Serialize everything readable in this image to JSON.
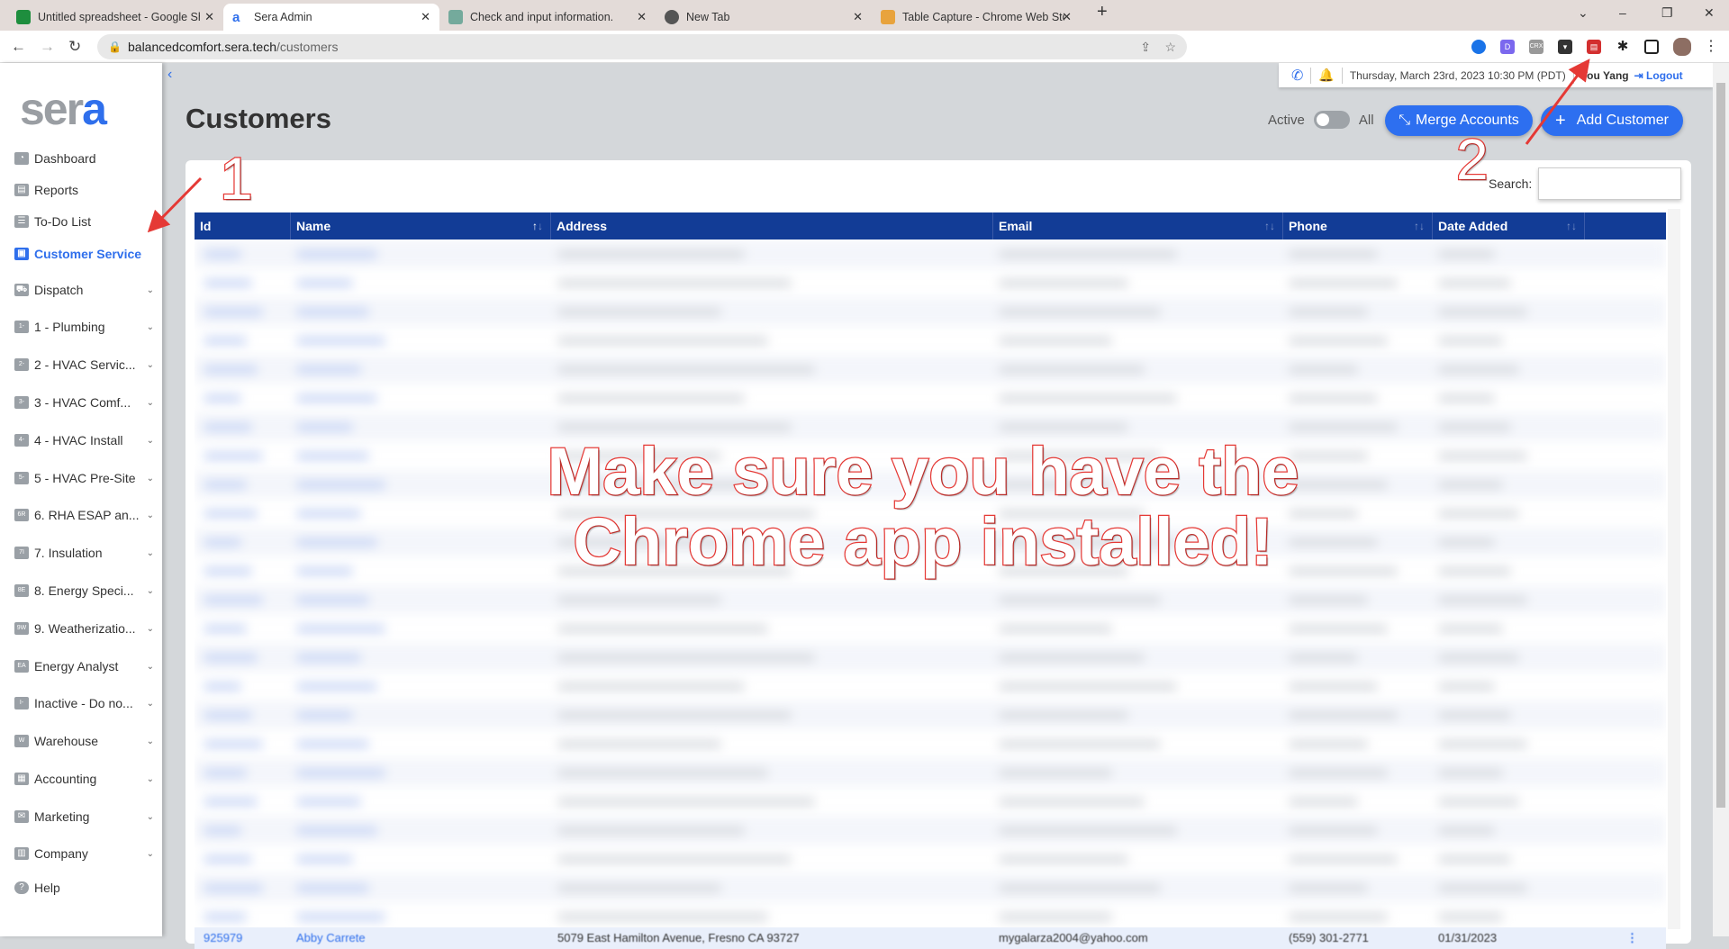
{
  "browser": {
    "tabs": [
      {
        "title": "Untitled spreadsheet - Google Sh",
        "color": "#1e8e3e"
      },
      {
        "title": "Sera Admin",
        "color": "#2f6fec",
        "active": true
      },
      {
        "title": "Check and input information.",
        "color": "#74aa9c"
      },
      {
        "title": "New Tab",
        "color": "#555555"
      },
      {
        "title": "Table Capture - Chrome Web Sto",
        "color": "#e8a33d"
      }
    ],
    "new_tab": "+",
    "url_host": "balancedcomfort.sera.tech",
    "url_path": "/customers",
    "extensions": [
      "onepassword-icon",
      "d-extension-icon",
      "crx-icon",
      "pocket-icon",
      "table-capture-icon",
      "puzzle-icon",
      "sidepanel-icon",
      "profile-avatar"
    ]
  },
  "sidebar": {
    "logo": "sera",
    "items": [
      {
        "label": "Dashboard",
        "icon": "pie-chart-icon",
        "badge": ""
      },
      {
        "label": "Reports",
        "icon": "report-icon",
        "badge": ""
      },
      {
        "label": "To-Do List",
        "icon": "list-icon",
        "badge": ""
      },
      {
        "label": "Customer Service",
        "icon": "contact-card-icon",
        "badge": "",
        "active": true
      },
      {
        "label": "Dispatch",
        "icon": "truck-icon",
        "badge": "",
        "chevron": true
      },
      {
        "label": "1 - Plumbing",
        "badge": "1-",
        "chevron": true
      },
      {
        "label": "2 - HVAC Servic...",
        "badge": "2-",
        "chevron": true
      },
      {
        "label": "3 - HVAC Comf...",
        "badge": "3-",
        "chevron": true
      },
      {
        "label": "4 - HVAC Install",
        "badge": "4-",
        "chevron": true
      },
      {
        "label": "5 - HVAC Pre-Site",
        "badge": "5-",
        "chevron": true
      },
      {
        "label": "6. RHA ESAP an...",
        "badge": "6R",
        "chevron": true
      },
      {
        "label": "7. Insulation",
        "badge": "7I",
        "chevron": true
      },
      {
        "label": "8. Energy Speci...",
        "badge": "8E",
        "chevron": true
      },
      {
        "label": "9. Weatherizatio...",
        "badge": "9W",
        "chevron": true
      },
      {
        "label": "Energy Analyst",
        "badge": "EA",
        "chevron": true
      },
      {
        "label": "Inactive - Do no...",
        "badge": "I-",
        "chevron": true
      },
      {
        "label": "Warehouse",
        "badge": "W",
        "chevron": true
      },
      {
        "label": "Accounting",
        "icon": "calculator-icon",
        "badge": "",
        "chevron": true
      },
      {
        "label": "Marketing",
        "icon": "envelope-icon",
        "badge": "",
        "chevron": true
      },
      {
        "label": "Company",
        "icon": "building-icon",
        "badge": "",
        "chevron": true
      },
      {
        "label": "Help",
        "icon": "help-icon",
        "badge": ""
      }
    ]
  },
  "topbar": {
    "datetime": "Thursday, March 23rd, 2023 10:30 PM (PDT)",
    "user": "Tou Yang",
    "logout": "Logout"
  },
  "page": {
    "title": "Customers",
    "toggle_active": "Active",
    "toggle_all": "All",
    "merge_button": "Merge Accounts",
    "add_button": "Add Customer",
    "search_label": "Search:",
    "search_value": ""
  },
  "table": {
    "columns": [
      "Id",
      "Name",
      "Address",
      "Email",
      "Phone",
      "Date Added",
      ""
    ],
    "partial_row": [
      "925979",
      "Abby Carrete",
      "5079 East Hamilton Avenue, Fresno CA 93727",
      "mygalarza2004@yahoo.com",
      "(559) 301-2771",
      "01/31/2023",
      "⋮"
    ]
  },
  "annotations": {
    "message_line1": "Make sure you have the",
    "message_line2": "Chrome app installed!",
    "marker1": "1",
    "marker2": "2",
    "color": "#e53935"
  }
}
